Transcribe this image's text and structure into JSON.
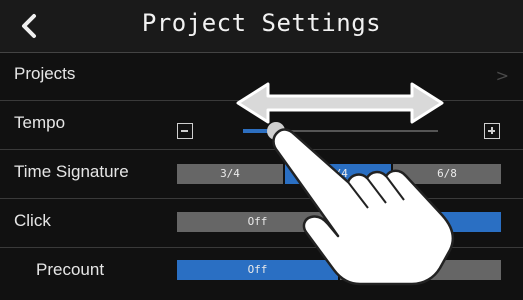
{
  "header": {
    "title": "Project Settings",
    "back_icon": "chevron-left-icon"
  },
  "rows": {
    "projects": {
      "label": "Projects",
      "chevron": ">"
    },
    "tempo": {
      "label": "Tempo",
      "minus_icon": "minus-box-icon",
      "plus_icon": "plus-box-icon",
      "slider_level_percent": 17
    },
    "time_signature": {
      "label": "Time Signature",
      "options": [
        "3/4",
        "4/4",
        "6/8"
      ],
      "selected": "4/4"
    },
    "click": {
      "label": "Click",
      "options": [
        "Off",
        "On"
      ],
      "selected": "On"
    },
    "precount": {
      "label": "Precount",
      "options": [
        "Off",
        "On"
      ],
      "selected": "Off"
    }
  },
  "overlay": {
    "icons": [
      "double-arrow-icon",
      "pointing-hand-icon"
    ]
  },
  "colors": {
    "background": "#111111",
    "selected_segment": "#2a6fc3",
    "unselected_segment": "#666666",
    "text": "#e6e6e6"
  }
}
